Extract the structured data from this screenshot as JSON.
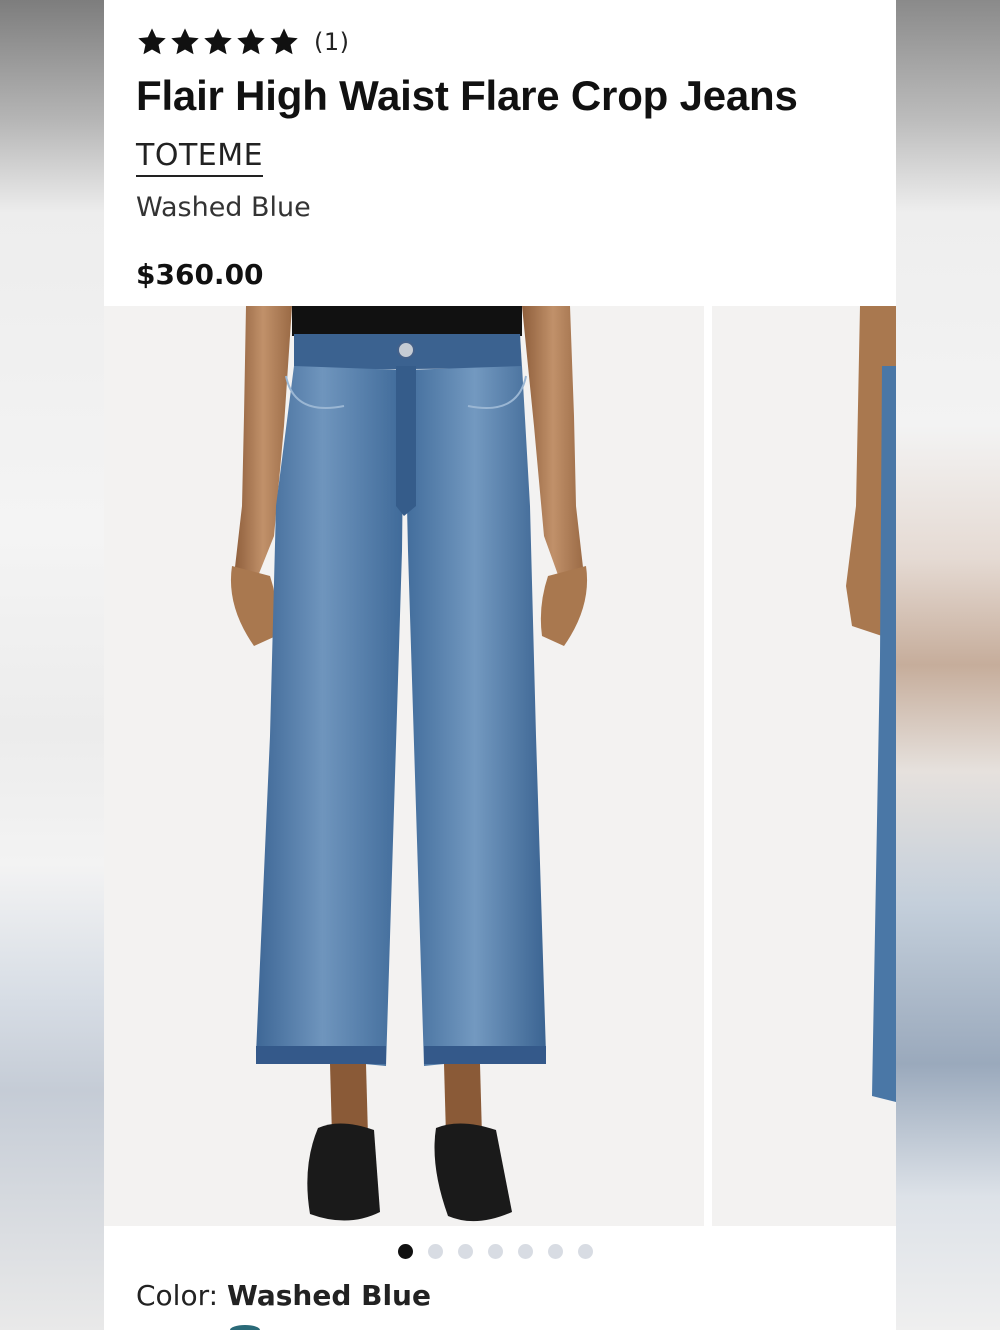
{
  "product": {
    "rating_stars": 5,
    "review_count": "(1)",
    "title": "Flair High Waist Flare Crop Jeans",
    "brand": "TOTEME",
    "color_name": "Washed Blue",
    "price": "$360.00"
  },
  "gallery": {
    "images": [
      {
        "icon": "jeans-front-photo",
        "description_colors": {
          "denim": "#4f7aa8",
          "skin": "#b5835a",
          "top": "#111111",
          "shoes": "#1a1a1a"
        }
      },
      {
        "icon": "jeans-side-photo"
      }
    ],
    "dot_count": 7,
    "active_dot": 0
  },
  "color_selector": {
    "label": "Color:",
    "selected": "Washed Blue"
  },
  "colors": {
    "text_primary": "#111111",
    "dot_active": "#111111",
    "dot_inactive": "#d8dce3"
  }
}
